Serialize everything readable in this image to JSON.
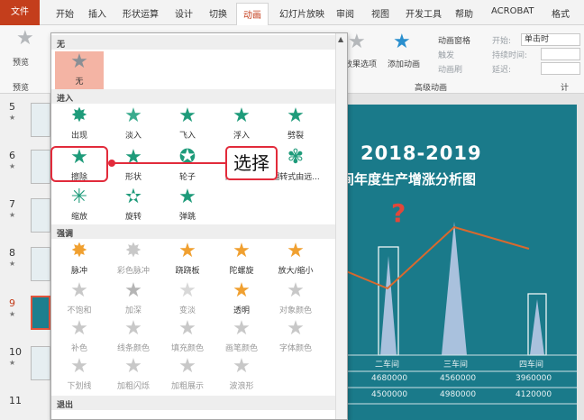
{
  "ribbon_tabs": [
    "文件",
    "开始",
    "插入",
    "形状运算",
    "设计",
    "切换",
    "动画",
    "幻灯片放映",
    "审阅",
    "视图",
    "开发工具",
    "帮助",
    "ACROBAT",
    "格式"
  ],
  "active_tab": "动画",
  "ribbon": {
    "preview_label": "预览",
    "preview_group": "预览",
    "effect_options": "效果选项",
    "add_animation": "添加动画",
    "animation_pane": "动画窗格",
    "trigger": "触发",
    "animation_painter": "动画刷",
    "advanced_group": "高级动画",
    "start_label": "开始:",
    "start_value": "单击时",
    "duration_label": "持续时间:",
    "delay_label": "延迟:",
    "timing_group": "计"
  },
  "thumbnails": [
    {
      "num": "5"
    },
    {
      "num": "6"
    },
    {
      "num": "7"
    },
    {
      "num": "8"
    },
    {
      "num": "9"
    },
    {
      "num": "10"
    },
    {
      "num": "11"
    }
  ],
  "gallery": {
    "none_header": "无",
    "none_item": "无",
    "entrance_header": "进入",
    "entrance": [
      "出现",
      "淡入",
      "飞入",
      "浮入",
      "劈裂",
      "擦除",
      "形状",
      "轮子",
      "随机线条",
      "翻转式由远...",
      "缩放",
      "旋转",
      "弹跳"
    ],
    "emphasis_header": "强调",
    "emphasis": [
      "脉冲",
      "彩色脉冲",
      "跷跷板",
      "陀螺旋",
      "放大/缩小",
      "不饱和",
      "加深",
      "变淡",
      "透明",
      "对象颜色",
      "补色",
      "线条颜色",
      "填充颜色",
      "画笔颜色",
      "字体颜色",
      "下划线",
      "加粗闪烁",
      "加粗展示",
      "波浪形"
    ],
    "exit_header": "退出"
  },
  "callout": "选择",
  "slide": {
    "title_year": "2018-2019",
    "title_sub": "间年度生产增涨分析图",
    "table_headers": [
      "二车间",
      "三车间",
      "四车间"
    ],
    "row1": [
      "4680000",
      "4560000",
      "3960000"
    ],
    "row2": [
      "4500000",
      "4980000",
      "4120000"
    ]
  },
  "chart_data": {
    "type": "bar",
    "categories": [
      "二车间",
      "三车间",
      "四车间"
    ],
    "series": [
      {
        "values": [
          4680000,
          4560000,
          3960000
        ]
      },
      {
        "values": [
          4500000,
          4980000,
          4120000
        ]
      }
    ]
  },
  "colors": {
    "accent": "#c43e1c",
    "slide_bg": "#1a7a8a",
    "callout": "#e22b3b",
    "selection": "#f4b4a4"
  }
}
